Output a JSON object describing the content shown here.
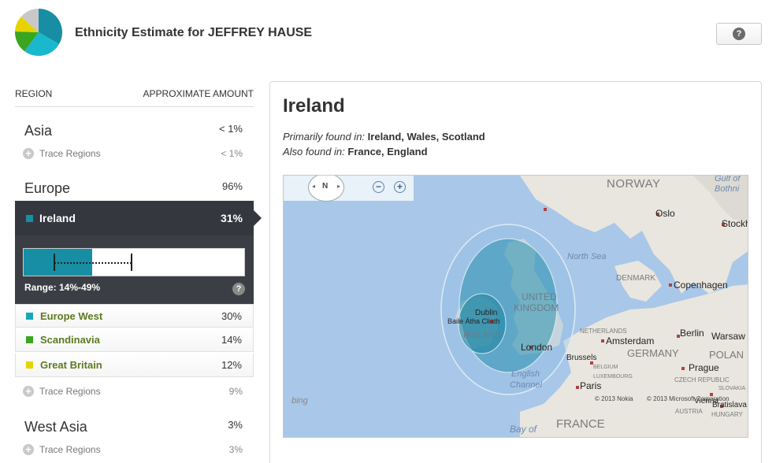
{
  "header": {
    "title": "Ethnicity Estimate for JEFFREY HAUSE",
    "help_label": "?"
  },
  "table": {
    "col_region": "REGION",
    "col_amount": "APPROXIMATE AMOUNT",
    "trace_icon": "+",
    "regions": [
      {
        "name": "Asia",
        "pct": "< 1%",
        "trace_label": "Trace Regions",
        "trace_pct": "< 1%"
      },
      {
        "name": "Europe",
        "pct": "96%",
        "selected": {
          "name": "Ireland",
          "pct": "31%",
          "color": "#178ea3",
          "range_label": "Range: 14%-49%",
          "value": 31,
          "range": [
            14,
            49
          ],
          "help": "?"
        },
        "subregions": [
          {
            "name": "Europe West",
            "pct": "30%",
            "color": "#1aa6b7"
          },
          {
            "name": "Scandinavia",
            "pct": "14%",
            "color": "#3aa520"
          },
          {
            "name": "Great Britain",
            "pct": "12%",
            "color": "#e6d400"
          }
        ],
        "trace_label": "Trace Regions",
        "trace_pct": "9%"
      },
      {
        "name": "West Asia",
        "pct": "3%",
        "trace_label": "Trace Regions",
        "trace_pct": "3%"
      }
    ]
  },
  "detail": {
    "title": "Ireland",
    "primary_label": "Primarily found in:",
    "primary_value": "Ireland, Wales, Scotland",
    "also_label": "Also found in:",
    "also_value": "France, England"
  },
  "map": {
    "compass_n": "N",
    "compass_left": "◂",
    "compass_right": "▸",
    "zoom_out": "−",
    "zoom_in": "+",
    "labels": {
      "norway": "NORWAY",
      "gulf1": "Gulf of",
      "gulf2": "Bothni",
      "oslo": "Oslo",
      "stockholm": "Stockh",
      "north_sea": "North Sea",
      "denmark": "DENMARK",
      "copenhagen": "Copenhagen",
      "uk1": "UNITED",
      "uk2": "KINGDOM",
      "dublin": "Dublin",
      "baile": "Baile Átha Cliath",
      "ireland": "IRELAND",
      "london": "London",
      "netherlands": "NETHERLANDS",
      "amsterdam": "Amsterdam",
      "berlin": "Berlin",
      "warsaw": "Warsaw",
      "germany": "GERMANY",
      "poland": "POLAN",
      "brussels": "Brussels",
      "belgium": "BELGIUM",
      "luxembourg": "LUXEMBOURG",
      "prague": "Prague",
      "czech": "CZECH REPUBLIC",
      "english1": "English",
      "english2": "Channel",
      "paris": "Paris",
      "slovakia": "SLOVAKIA",
      "vienna": "Vienna",
      "bratislava": "Bratislava",
      "austria": "AUSTRIA",
      "hungary": "HUNGARY",
      "france": "FRANCE",
      "bay": "Bay of",
      "bing": "bing",
      "copy1": "© 2013 Nokia",
      "copy2": "© 2013 Microsoft Corporation"
    }
  },
  "logo_colors": [
    "#178ea3",
    "#1ab8cc",
    "#3aa520",
    "#e6d400",
    "#c8c8c8"
  ]
}
